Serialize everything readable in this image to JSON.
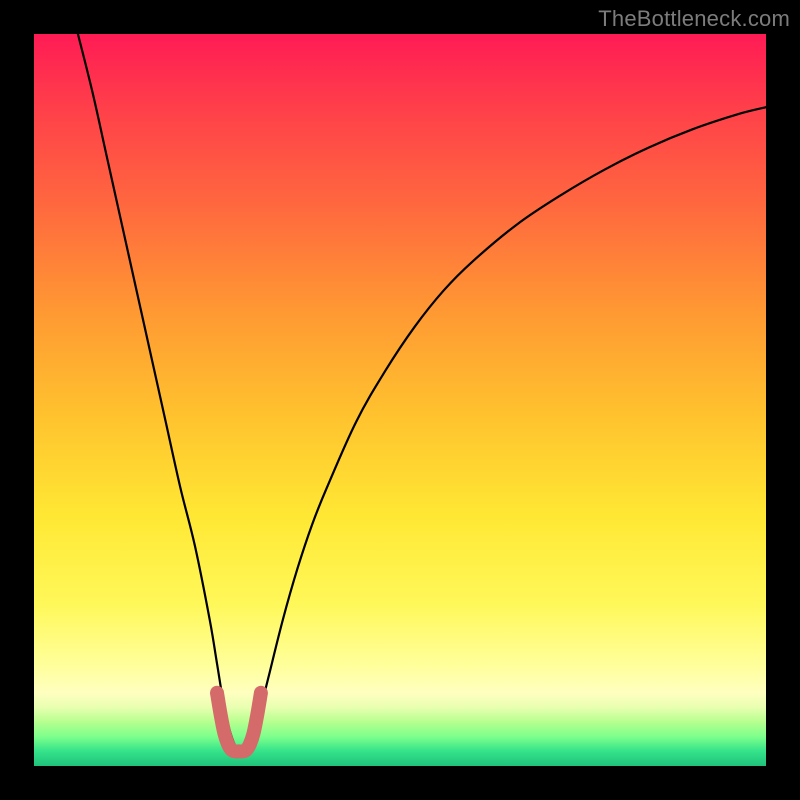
{
  "watermark": "TheBottleneck.com",
  "chart_data": {
    "type": "line",
    "title": "",
    "xlabel": "",
    "ylabel": "",
    "xlim": [
      0,
      100
    ],
    "ylim": [
      0,
      100
    ],
    "grid": false,
    "legend": false,
    "series": [
      {
        "name": "bottleneck-main-curve",
        "color": "#000000",
        "x": [
          6,
          8,
          10,
          12,
          14,
          16,
          18,
          20,
          22,
          24,
          25,
          26,
          27,
          28,
          29,
          30,
          31,
          32,
          34,
          36,
          38,
          40,
          44,
          48,
          52,
          56,
          60,
          66,
          72,
          78,
          84,
          90,
          96,
          100
        ],
        "y": [
          100,
          92,
          83,
          74,
          65,
          56,
          47,
          38,
          30,
          20,
          14,
          8,
          4,
          2,
          2,
          4,
          8,
          12,
          20,
          27,
          33,
          38,
          47,
          54,
          60,
          65,
          69,
          74,
          78,
          81.5,
          84.5,
          87,
          89,
          90
        ]
      },
      {
        "name": "bottleneck-trough-highlight",
        "color": "#d46a6a",
        "x": [
          25,
          25.5,
          26,
          26.5,
          27,
          27.5,
          28,
          28.5,
          29,
          29.5,
          30,
          30.5,
          31
        ],
        "y": [
          10,
          7,
          4.5,
          3,
          2.2,
          2,
          2,
          2,
          2.2,
          3,
          4.5,
          7,
          10
        ]
      }
    ],
    "gradient_stops": [
      {
        "pos": 0,
        "color": "#ff1b55"
      },
      {
        "pos": 10,
        "color": "#ff3f4a"
      },
      {
        "pos": 24,
        "color": "#ff6a3e"
      },
      {
        "pos": 38,
        "color": "#ff9933"
      },
      {
        "pos": 52,
        "color": "#ffc22e"
      },
      {
        "pos": 66,
        "color": "#ffe834"
      },
      {
        "pos": 78,
        "color": "#fff85a"
      },
      {
        "pos": 86,
        "color": "#ffff99"
      },
      {
        "pos": 90,
        "color": "#ffffc0"
      },
      {
        "pos": 92,
        "color": "#e8ffb0"
      },
      {
        "pos": 94,
        "color": "#b6ff8e"
      },
      {
        "pos": 96,
        "color": "#7dff8c"
      },
      {
        "pos": 98,
        "color": "#34e38a"
      },
      {
        "pos": 100,
        "color": "#1fc27a"
      }
    ]
  }
}
